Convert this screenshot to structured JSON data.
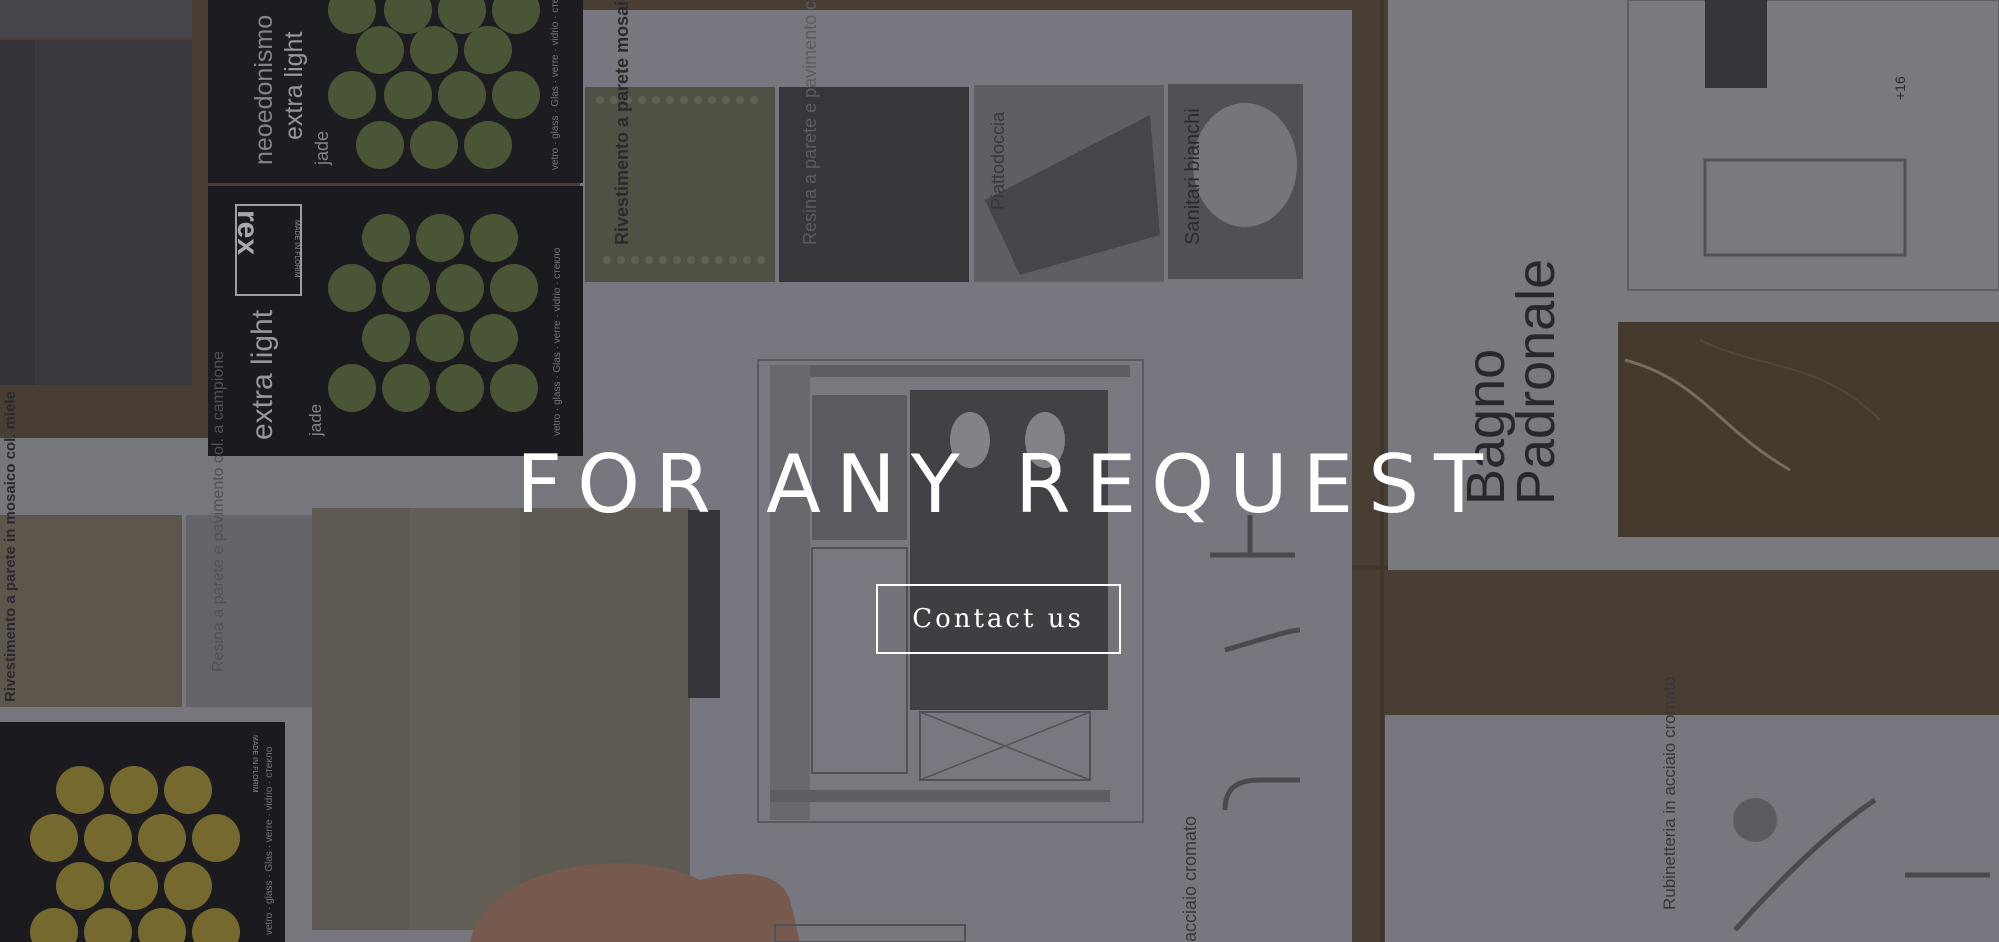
{
  "hero": {
    "headline": "FOR ANY REQUEST",
    "button_label": "Contact us"
  },
  "photo": {
    "tile_cards": {
      "top": {
        "brand": "neoedonismo",
        "line": "extra light",
        "color": "jade",
        "materials": "vetro · glass · Glas · verre · vidrio · cтекло"
      },
      "middle": {
        "logo": "rex",
        "logo_sub": "MADE IN FLORIM",
        "line": "extra light",
        "color": "jade",
        "materials": "vetro · glass · Glas · verre · vidrio · cтекло"
      },
      "bottom": {
        "logo_sub": "MADE IN FLORIM",
        "materials": "vetro · glass · Glas · verre · vidrio · cтекло"
      }
    },
    "sheet_labels": {
      "mosaic_top": "Rivestimento a parete mosaico col. jade",
      "resin_top": "Resina a parete e pavimento col. a campione",
      "shower": "Piattodoccia",
      "sanitary": "Sanitari bianchi",
      "mosaic_left": "Rivestimento a parete in mosaico col. miele",
      "resin_left": "Resina a parete e pavimento col. a campione",
      "bathroom_title_1": "Bagno",
      "bathroom_title_2": "Padronale",
      "taps_right": "Rubinetteria in acciaio cromato",
      "taps_center": "acciaio cromato",
      "elevation": "+16"
    }
  },
  "colors": {
    "headline": "#ffffff",
    "button_border": "#ffffff",
    "wood": "#5a4a3a",
    "paper": "#8e8f96",
    "tile_card": "#1e1e22",
    "jade_glass": "#5b6a3a",
    "honey_glass": "#9c8b3a"
  }
}
